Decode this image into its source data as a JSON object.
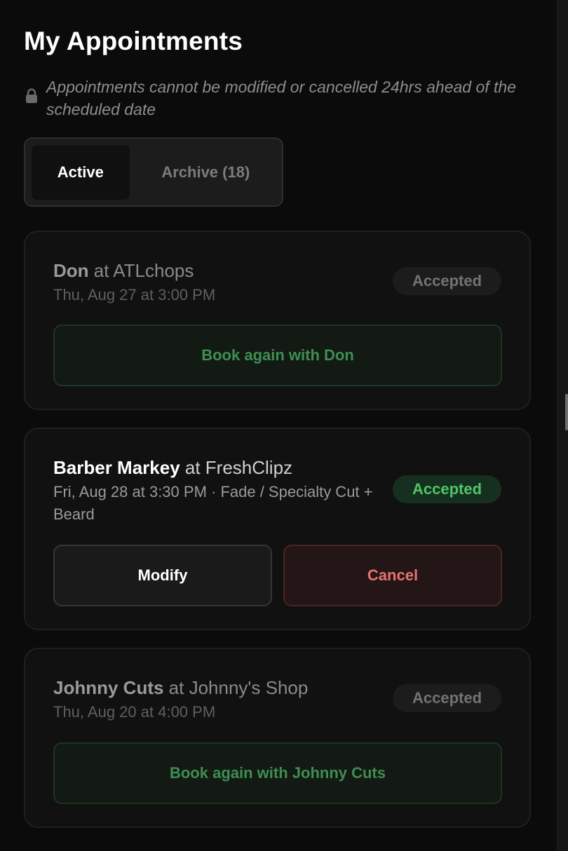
{
  "header": {
    "title": "My Appointments",
    "notice": "Appointments cannot be modified or cancelled 24hrs ahead of the scheduled date",
    "notice_icon": "lock-icon"
  },
  "tabs": [
    {
      "label": "Active",
      "selected": true
    },
    {
      "label": "Archive (18)",
      "selected": false
    }
  ],
  "appointments": [
    {
      "barber": "Don",
      "at": " at ",
      "shop": "ATLchops",
      "datetime": "Thu, Aug 27 at 3:00 PM",
      "status": "Accepted",
      "action_label": "Book again with Don"
    },
    {
      "barber": "Barber Markey",
      "at": " at ",
      "shop": "FreshClipz",
      "datetime": "Fri, Aug 28 at 3:30 PM · Fade / Specialty Cut + Beard",
      "status": "Accepted",
      "modify_label": "Modify",
      "cancel_label": "Cancel"
    },
    {
      "barber": "Johnny Cuts",
      "at": " at ",
      "shop": "Johnny's Shop",
      "datetime": "Thu, Aug 20 at 4:00 PM",
      "status": "Accepted",
      "action_label": "Book again with Johnny Cuts"
    }
  ],
  "colors": {
    "background": "#0b0b0b",
    "accepted_green": "#4fc468",
    "book_again_green": "#3f8e52",
    "cancel_red": "#e6736c"
  }
}
